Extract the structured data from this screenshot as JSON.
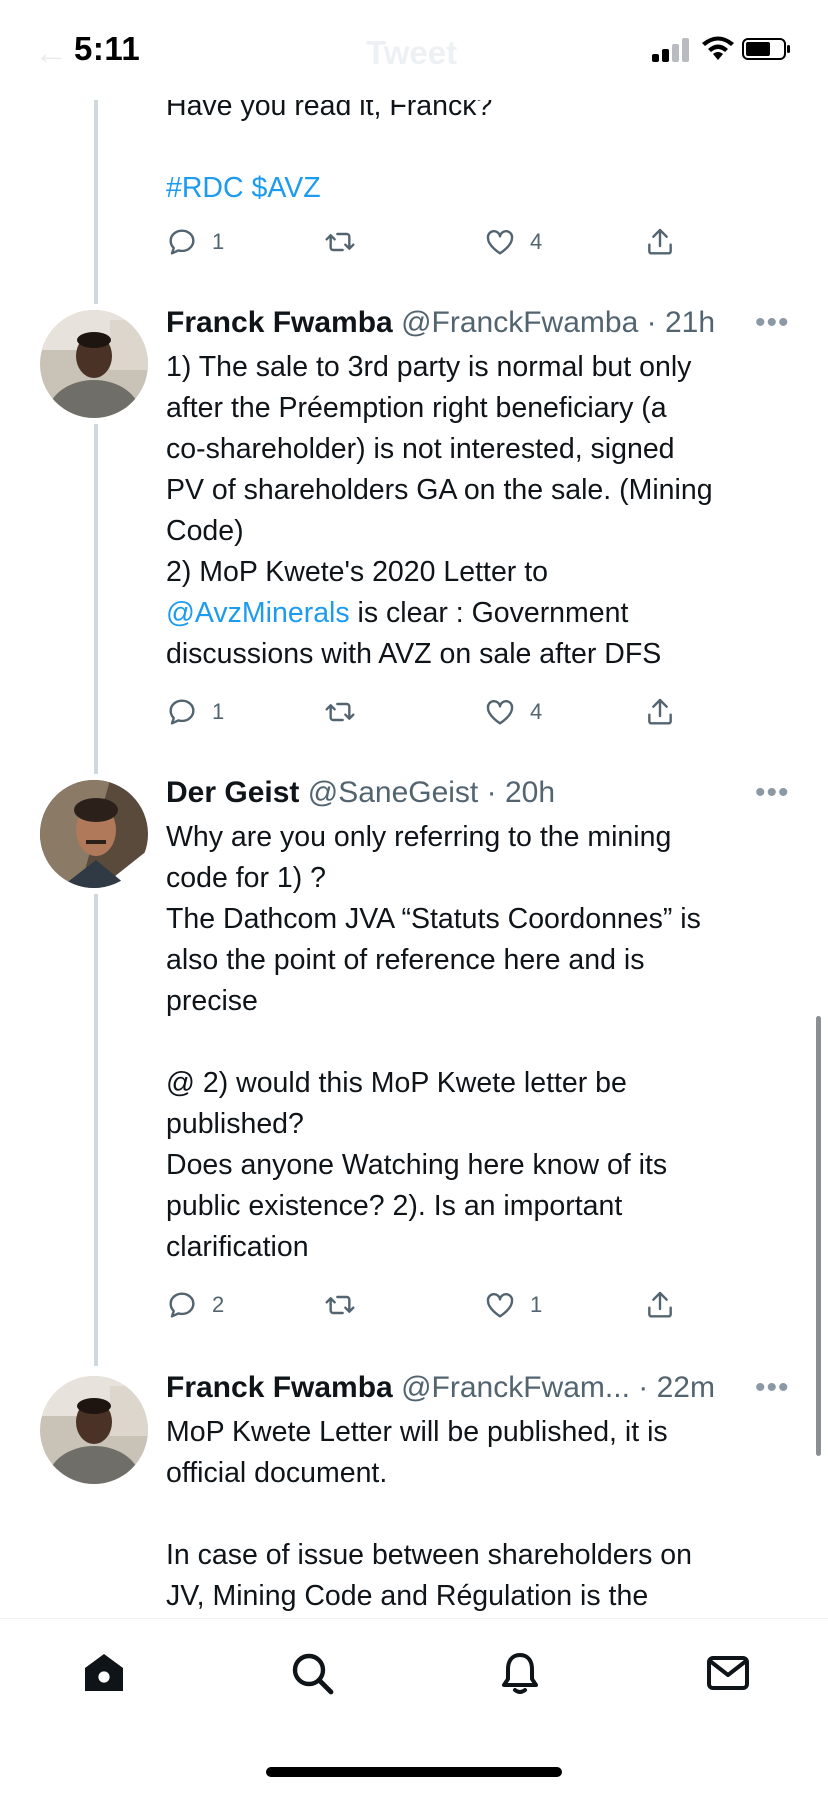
{
  "status_bar": {
    "time": "5:11"
  },
  "header": {
    "back": "←",
    "title": "Tweet"
  },
  "previous_tweet_tail": {
    "lines": [
      "Have you read it, Franck?"
    ],
    "hashtags": "#RDC $AVZ",
    "actions": {
      "reply_count": "1",
      "retweet_count": "",
      "like_count": "4"
    }
  },
  "tweets": [
    {
      "name": "Franck Fwamba",
      "handle": "@FranckFwamba",
      "time": "· 21h",
      "more": "•••",
      "lines": [
        "1) The sale to 3rd party is normal but only",
        "after the Préemption right beneficiary (a",
        "co-shareholder) is not interested, signed",
        "PV of shareholders GA on the sale. (Mining",
        "Code)",
        "2) MoP Kwete's 2020 Letter to"
      ],
      "mention": "@AvzMinerals",
      "mention_suffix": " is clear : Government",
      "last_line": "discussions with AVZ on sale after DFS",
      "actions": {
        "reply_count": "1",
        "retweet_count": "",
        "like_count": "4"
      }
    },
    {
      "name": "Der Geist",
      "handle": "@SaneGeist",
      "time": "· 20h",
      "more": "•••",
      "lines_a": [
        "Why are you only referring to the mining",
        "code for 1) ?",
        "The Dathcom JVA “Statuts Coordonnes” is",
        "also the point of reference here and is",
        "precise"
      ],
      "lines_b": [
        "@ 2) would this MoP Kwete letter be",
        "published?",
        "Does anyone Watching here know of its",
        "public existence? 2). Is an important",
        "clarification"
      ],
      "actions": {
        "reply_count": "2",
        "retweet_count": "",
        "like_count": "1"
      }
    },
    {
      "name": "Franck Fwamba",
      "handle": "@FranckFwam...",
      "time": "· 22m",
      "more": "•••",
      "lines_a": [
        "MoP Kwete Letter will be published, it is",
        "official document."
      ],
      "lines_b": [
        "In case of issue between shareholders on",
        "JV, Mining Code and Régulation is the"
      ]
    }
  ],
  "bottom_nav": [
    "home-icon",
    "search-icon",
    "notifications-icon",
    "messages-icon"
  ],
  "colors": {
    "link": "#1d9bf0",
    "text": "#0f1419",
    "secondary": "#536471",
    "thread": "#cfd9de"
  }
}
